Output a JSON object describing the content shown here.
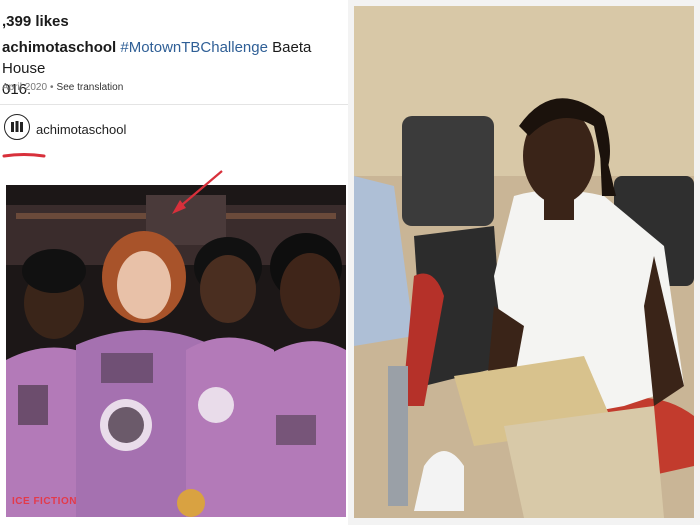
{
  "post": {
    "likes": ",399 likes",
    "username": "achimotaschool",
    "hashtag": "#MotownTBChallenge",
    "caption_rest": " Baeta House",
    "caption_line2": "016.",
    "date": "April 2020",
    "separator": "•",
    "translate_link": "See translation"
  },
  "account": {
    "name": "achimotaschool",
    "avatar_icon": "school-crest-icon"
  },
  "photos": {
    "left": "group-photo",
    "right": "portrait-photo"
  },
  "annotations": {
    "arrow_icon": "red-arrow-icon",
    "underline_icon": "red-underline-icon",
    "watermark": "ICE FICTION"
  },
  "colors": {
    "hashtag": "#2f5f96",
    "annotation_red": "#d8303b",
    "uniform": "#b37ab8"
  }
}
